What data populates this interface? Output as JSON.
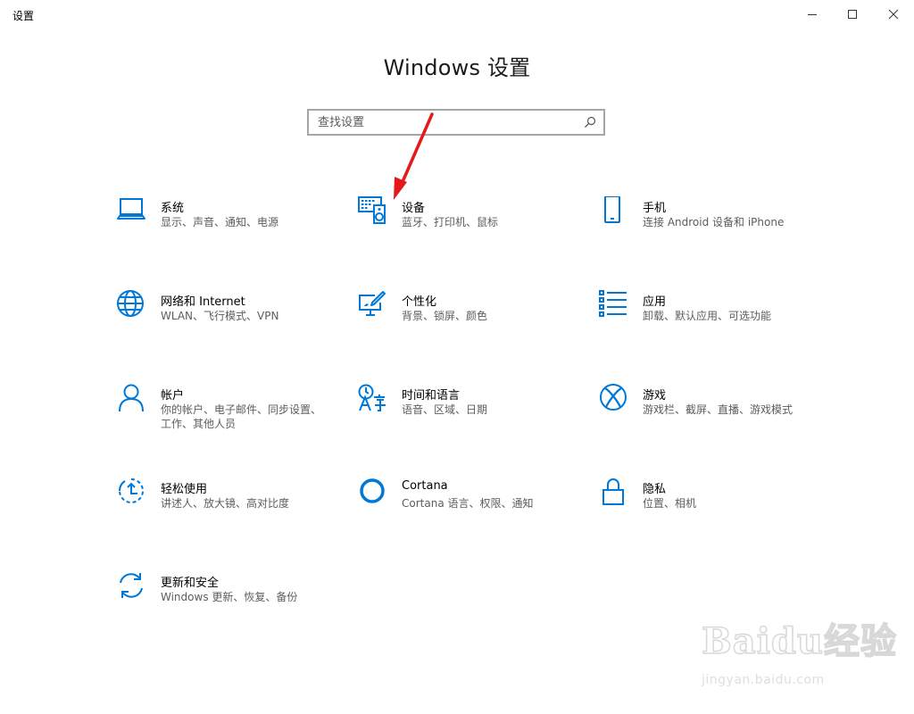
{
  "window": {
    "title": "设置",
    "controls": {
      "minimize": "minimize-icon",
      "maximize": "maximize-icon",
      "close": "close-icon"
    }
  },
  "page": {
    "title": "Windows 设置"
  },
  "search": {
    "placeholder": "查找设置",
    "icon": "search-icon"
  },
  "accent_color": "#0078d7",
  "annotation_arrow_color": "#e5191b",
  "categories": [
    {
      "id": "system",
      "title": "系统",
      "desc": "显示、声音、通知、电源",
      "icon": "laptop-icon"
    },
    {
      "id": "devices",
      "title": "设备",
      "desc": "蓝牙、打印机、鼠标",
      "icon": "keyboard-speaker-icon"
    },
    {
      "id": "phone",
      "title": "手机",
      "desc": "连接 Android 设备和 iPhone",
      "icon": "phone-icon"
    },
    {
      "id": "network",
      "title": "网络和 Internet",
      "desc": "WLAN、飞行模式、VPN",
      "icon": "globe-icon"
    },
    {
      "id": "personalization",
      "title": "个性化",
      "desc": "背景、锁屏、颜色",
      "icon": "paint-brush-icon"
    },
    {
      "id": "apps",
      "title": "应用",
      "desc": "卸载、默认应用、可选功能",
      "icon": "app-list-icon"
    },
    {
      "id": "accounts",
      "title": "帐户",
      "desc": "你的帐户、电子邮件、同步设置、工作、其他人员",
      "icon": "person-icon"
    },
    {
      "id": "time-language",
      "title": "时间和语言",
      "desc": "语音、区域、日期",
      "icon": "time-language-icon"
    },
    {
      "id": "gaming",
      "title": "游戏",
      "desc": "游戏栏、截屏、直播、游戏模式",
      "icon": "xbox-icon"
    },
    {
      "id": "ease-of-access",
      "title": "轻松使用",
      "desc": "讲述人、放大镜、高对比度",
      "icon": "ease-of-access-icon"
    },
    {
      "id": "cortana",
      "title": "Cortana",
      "desc": "Cortana 语言、权限、通知",
      "icon": "cortana-ring-icon"
    },
    {
      "id": "privacy",
      "title": "隐私",
      "desc": "位置、相机",
      "icon": "lock-icon"
    },
    {
      "id": "update-security",
      "title": "更新和安全",
      "desc": "Windows 更新、恢复、备份",
      "icon": "sync-arrows-icon"
    }
  ],
  "watermark": {
    "main": "Baidu经验",
    "sub": "jingyan.baidu.com"
  }
}
